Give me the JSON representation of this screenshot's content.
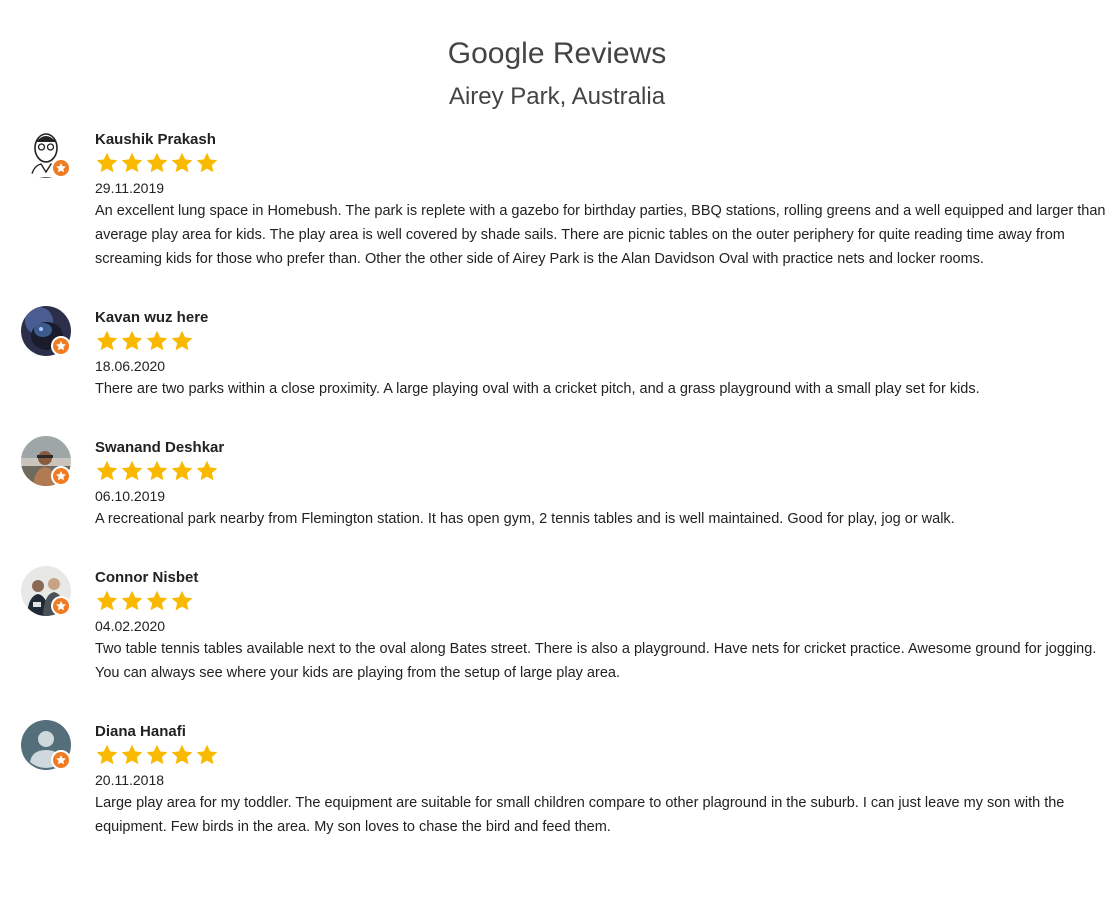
{
  "header": {
    "title": "Google Reviews",
    "subtitle": "Airey Park, Australia"
  },
  "colors": {
    "star": "#f9b900",
    "badge": "#ef7b22"
  },
  "reviews": [
    {
      "name": "Kaushik Prakash",
      "rating": 5,
      "date": "29.11.2019",
      "text": "An excellent lung space in Homebush. The park is replete with a gazebo for birthday parties, BBQ stations, rolling greens and a well equipped and larger than average play area for kids. The play area is well covered by shade sails. There are picnic tables on the outer periphery for quite reading time away from screaming kids for those who prefer than. Other the other side of Airey Park is the Alan Davidson Oval with practice nets and locker rooms.",
      "avatar_icon": "sketch-portrait-avatar"
    },
    {
      "name": "Kavan wuz here",
      "rating": 4,
      "date": "18.06.2020",
      "text": "There are two parks within a close proximity. A large playing oval with a cricket pitch, and a grass playground with a small play set for kids.",
      "avatar_icon": "dark-creature-avatar"
    },
    {
      "name": "Swanand Deshkar",
      "rating": 5,
      "date": "06.10.2019",
      "text": "A recreational park nearby from Flemington station. It has open gym, 2 tennis tables and is well maintained. Good for play, jog or walk.",
      "avatar_icon": "photo-person-avatar"
    },
    {
      "name": "Connor Nisbet",
      "rating": 4,
      "date": "04.02.2020",
      "text": "Two table tennis tables available next to the oval along Bates street. There is also a playground. Have nets for cricket practice. Awesome ground for jogging. You can always see where your kids are playing from the setup of large play area.",
      "avatar_icon": "group-photo-avatar"
    },
    {
      "name": "Diana Hanafi",
      "rating": 5,
      "date": "20.11.2018",
      "text": "Large play area for my toddler. The equipment are suitable for small children compare to other plaground in the suburb. I can just leave my son with the equipment. Few birds in the area. My son loves to chase the bird and feed them.",
      "avatar_icon": "default-user-avatar"
    }
  ]
}
